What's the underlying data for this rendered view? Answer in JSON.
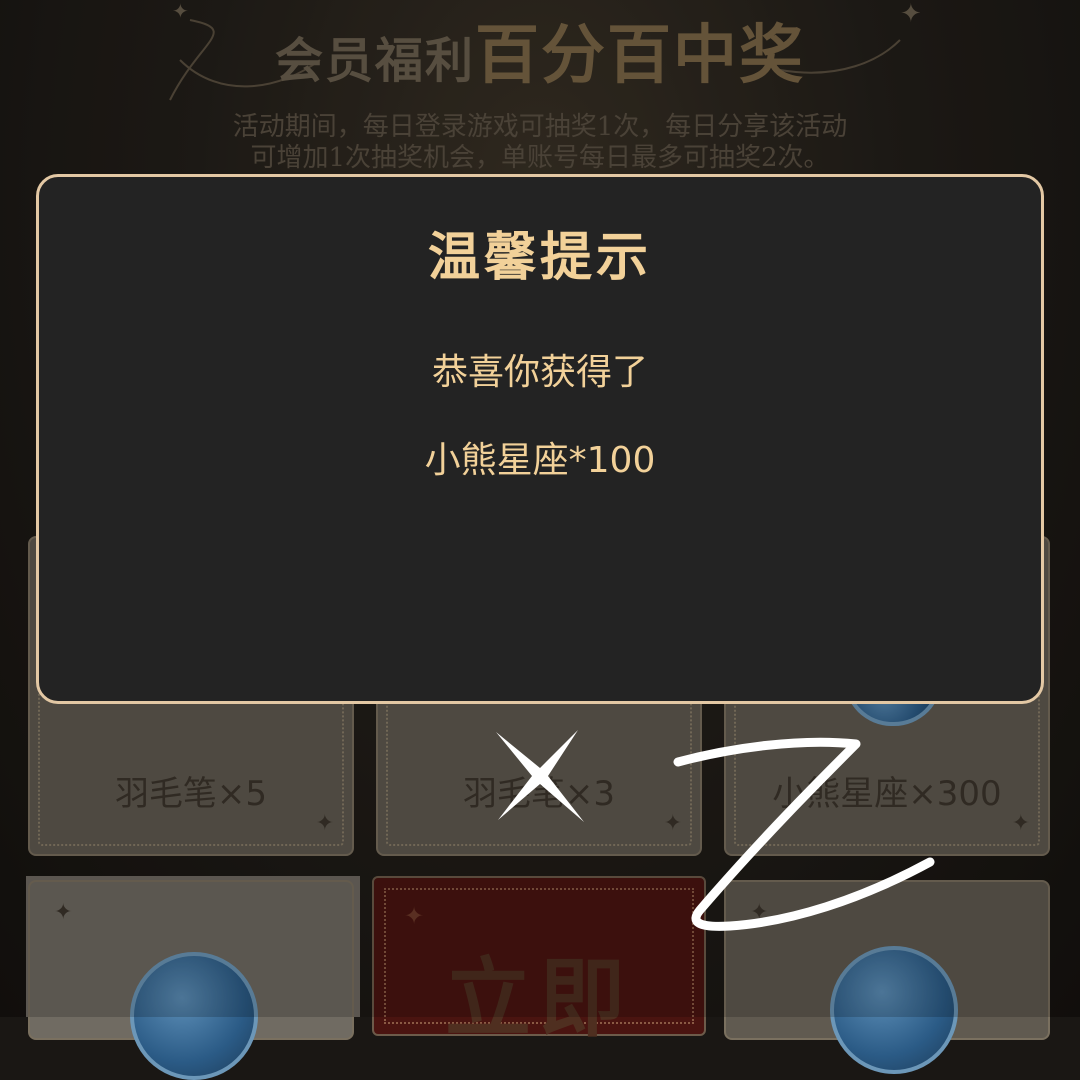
{
  "banner": {
    "title_small": "会员福利",
    "title_big": "百分百中奖",
    "desc_line1": "活动期间，每日登录游戏可抽奖1次，每日分享该活动",
    "desc_line2": "可增加1次抽奖机会，单账号每日最多可抽奖2次。"
  },
  "prizes": [
    {
      "label": "羽毛笔×5"
    },
    {
      "label": "羽毛笔×3"
    },
    {
      "label": "小熊星座×300"
    }
  ],
  "draw_button": {
    "label": "立即"
  },
  "modal": {
    "title": "温馨提示",
    "line1": "恭喜你获得了",
    "line2": "小熊星座*100"
  },
  "colors": {
    "accent": "#f2d199",
    "modal_bg": "#232323",
    "modal_border": "#e3c8a4"
  }
}
